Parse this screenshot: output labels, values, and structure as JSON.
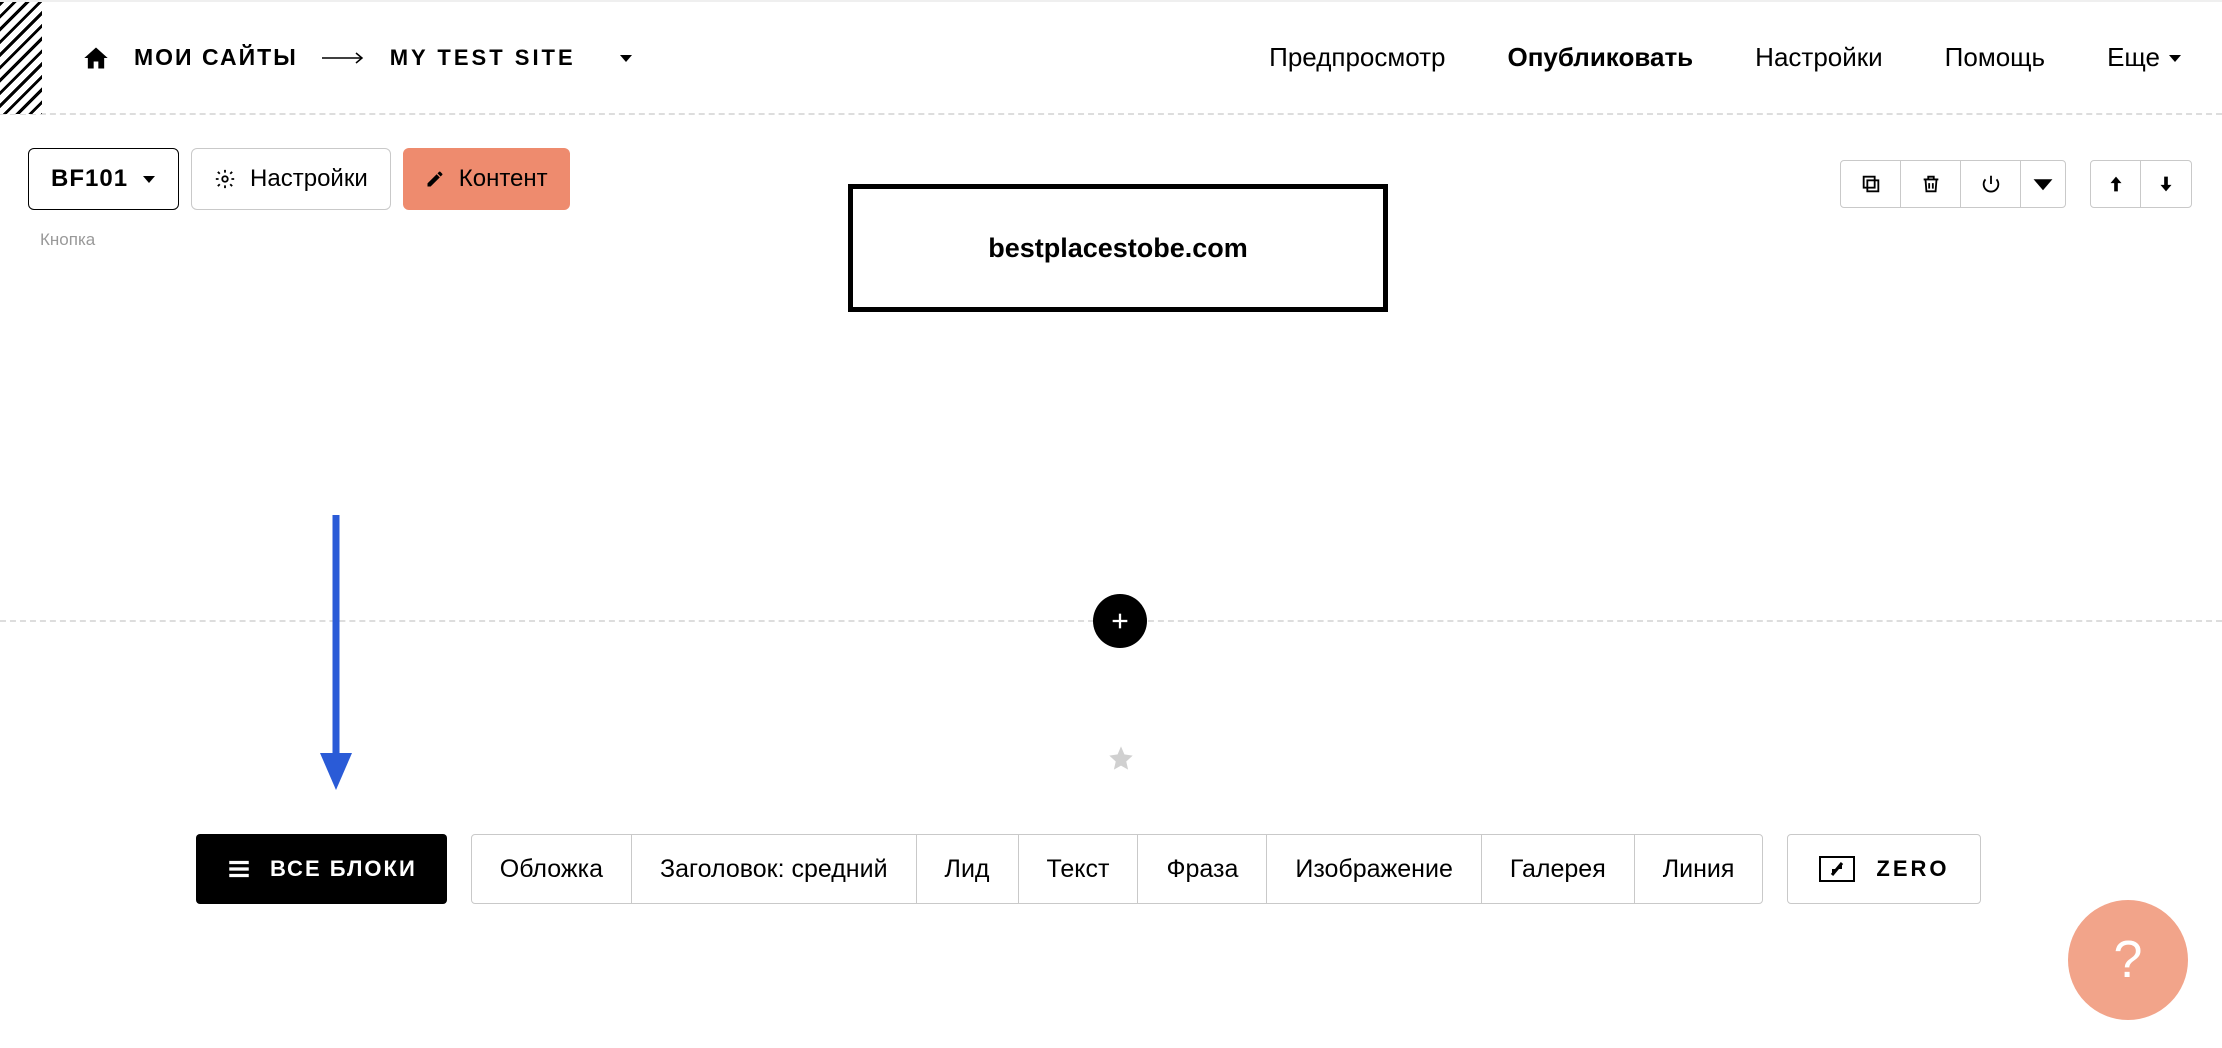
{
  "header": {
    "my_sites": "МОИ САЙТЫ",
    "site_name": "MY TEST SITE",
    "nav": {
      "preview": "Предпросмотр",
      "publish": "Опубликовать",
      "settings": "Настройки",
      "help": "Помощь",
      "more": "Еще"
    }
  },
  "toolbar": {
    "block_code": "BF101",
    "settings": "Настройки",
    "content": "Контент",
    "sublabel": "Кнопка"
  },
  "center_button": {
    "text": "bestplacestobe.com"
  },
  "blockbar": {
    "all_blocks": "ВСЕ БЛОКИ",
    "types": [
      "Обложка",
      "Заголовок: средний",
      "Лид",
      "Текст",
      "Фраза",
      "Изображение",
      "Галерея",
      "Линия"
    ],
    "zero": "ZERO"
  },
  "help": {
    "label": "?"
  }
}
